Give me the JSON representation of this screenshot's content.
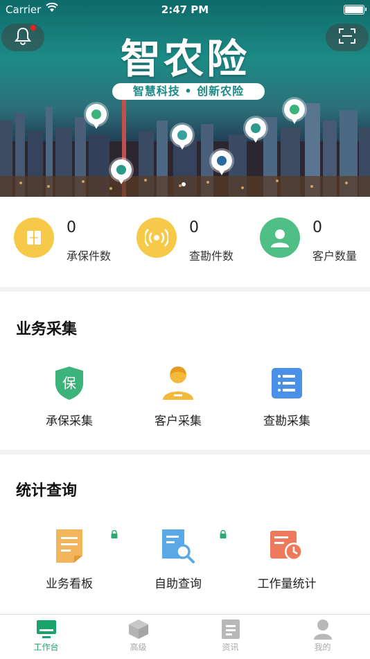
{
  "status_bar": {
    "carrier": "Carrier",
    "time": "2:47 PM"
  },
  "banner": {
    "title": "智农险",
    "slogan": "智慧科技 • 创新农险",
    "icons": [
      "notification-bell-icon",
      "scan-icon"
    ]
  },
  "stats": [
    {
      "value": "0",
      "label": "承保件数",
      "icon": "policy-book-icon",
      "color": "#f7c948"
    },
    {
      "value": "0",
      "label": "查勘件数",
      "icon": "signal-broadcast-icon",
      "color": "#f7c948"
    },
    {
      "value": "0",
      "label": "客户数量",
      "icon": "customer-person-icon",
      "color": "#4fbf85"
    }
  ],
  "business": {
    "title": "业务采集",
    "items": [
      {
        "label": "承保采集",
        "icon": "insurance-shield-icon",
        "glyph": "保",
        "color": "#3bb37a"
      },
      {
        "label": "客户采集",
        "icon": "customer-avatar-icon",
        "color": "#f5b93a"
      },
      {
        "label": "查勘采集",
        "icon": "survey-list-icon",
        "color": "#4a8fe8"
      }
    ]
  },
  "statistics": {
    "title": "统计查询",
    "items": [
      {
        "label": "业务看板",
        "icon": "business-board-icon",
        "color": "#f2b55c",
        "locked": true
      },
      {
        "label": "自助查询",
        "icon": "self-query-icon",
        "color": "#5aa9e6",
        "locked": true
      },
      {
        "label": "工作量统计",
        "icon": "workload-stats-icon",
        "color": "#ee7a5e",
        "locked": false
      }
    ]
  },
  "tabbar": {
    "active": "workbench",
    "items": [
      {
        "key": "workbench",
        "label": "工作台",
        "icon": "desktop-icon"
      },
      {
        "key": "advanced",
        "label": "高级",
        "icon": "cube-icon"
      },
      {
        "key": "news",
        "label": "资讯",
        "icon": "document-icon"
      },
      {
        "key": "mine",
        "label": "我的",
        "icon": "user-icon"
      }
    ]
  },
  "colors": {
    "accent": "#1aa36b",
    "lock": "#2aa870"
  }
}
